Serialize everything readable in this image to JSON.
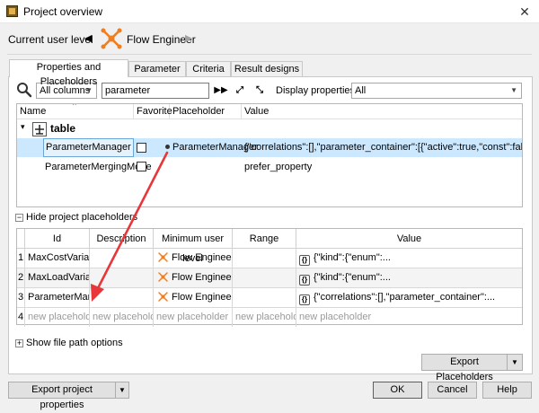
{
  "window": {
    "title": "Project overview",
    "close": "✕"
  },
  "user_level": {
    "label": "Current user level",
    "name": "Flow Engineer"
  },
  "tabs": [
    {
      "label": "Properties and Placeholders"
    },
    {
      "label": "Parameter"
    },
    {
      "label": "Criteria"
    },
    {
      "label": "Result designs"
    }
  ],
  "filter": {
    "column": "All columns",
    "query": "parameter",
    "display_label": "Display properties:",
    "display_value": "All"
  },
  "tree": {
    "headers": {
      "name": "Name",
      "favorite": "Favorite",
      "placeholder": "Placeholder",
      "value": "Value"
    },
    "group": "table",
    "rows": [
      {
        "name": "ParameterManager",
        "placeholder": "ParameterManager",
        "value": "{\"correlations\":[],\"parameter_container\":[{\"active\":true,\"const\":false,\"determini..."
      },
      {
        "name": "ParameterMergingMode",
        "placeholder": "",
        "value": "prefer_property"
      }
    ]
  },
  "placeholders_section": {
    "label": "Hide project placeholders"
  },
  "ph_table": {
    "headers": {
      "id": "Id",
      "description": "Description",
      "min_level": "Minimum user level",
      "range": "Range",
      "value": "Value"
    },
    "rows": [
      {
        "num": "1",
        "id": "MaxCostVariant",
        "description": "",
        "level": "Flow Engineer",
        "range": "",
        "value": "{\"kind\":{\"enum\":..."
      },
      {
        "num": "2",
        "id": "MaxLoadVariant",
        "description": "",
        "level": "Flow Engineer",
        "range": "",
        "value": "{\"kind\":{\"enum\":..."
      },
      {
        "num": "3",
        "id": "ParameterMan...",
        "description": "",
        "level": "Flow Engineer",
        "range": "",
        "value": "{\"correlations\":[],\"parameter_container\":..."
      }
    ],
    "new_row": {
      "num": "4",
      "text": "new placeholder"
    }
  },
  "file_paths": {
    "label": "Show file path options"
  },
  "buttons": {
    "export_placeholders": "Export Placeholders",
    "export_project": "Export project properties",
    "ok": "OK",
    "cancel": "Cancel",
    "help": "Help"
  },
  "colors": {
    "selection": "#cce8ff",
    "accent": "#0078d7",
    "arrow": "#e8373a",
    "user_icon": "#f07d1e"
  }
}
